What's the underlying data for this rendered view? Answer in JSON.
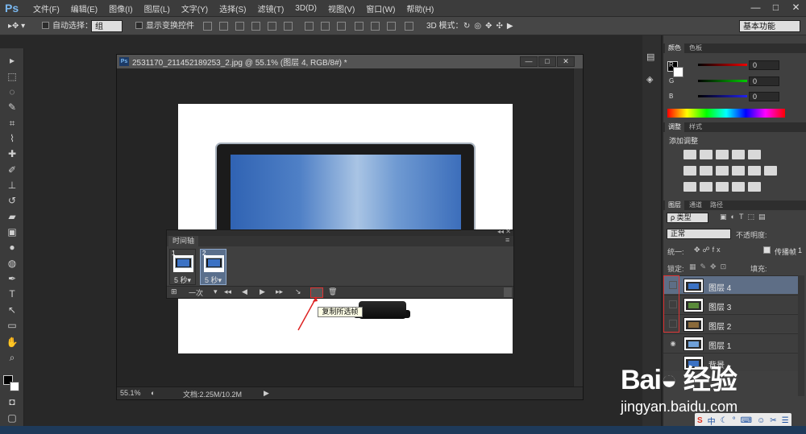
{
  "app": {
    "logo": "Ps"
  },
  "menubar": {
    "items": [
      "文件(F)",
      "编辑(E)",
      "图像(I)",
      "图层(L)",
      "文字(Y)",
      "选择(S)",
      "滤镜(T)",
      "3D(D)",
      "视图(V)",
      "窗口(W)",
      "帮助(H)"
    ],
    "min": "—",
    "max": "□",
    "close": "✕"
  },
  "options": {
    "auto_select": "自动选择：",
    "auto_select_value": "组",
    "show_transform": "显示变换控件",
    "mode3d": "3D 模式：",
    "workspace": "基本功能"
  },
  "document": {
    "title": "2531170_211452189253_2.jpg @ 55.1% (图层 4, RGB/8#) *",
    "zoom": "55.1%",
    "doc_info": "文档:2.25M/10.2M",
    "min": "—",
    "max": "□",
    "close": "✕"
  },
  "timeline": {
    "tab": "时间轴",
    "frames": [
      {
        "num": "1",
        "delay": "5 秒▾"
      },
      {
        "num": "2",
        "delay": "5 秒▾"
      }
    ],
    "loop": "一次",
    "tooltip": "复制所选帧"
  },
  "color_panel": {
    "tabs": [
      "颜色",
      "色板"
    ],
    "r_label": "R",
    "g_label": "G",
    "b_label": "B",
    "r": "0",
    "g": "0",
    "b": "0"
  },
  "adjust_panel": {
    "tabs": [
      "调整",
      "样式"
    ],
    "title": "添加调整"
  },
  "layers_panel": {
    "tabs": [
      "图层",
      "通道",
      "路径"
    ],
    "kind": "ρ 类型",
    "blend": "正常",
    "opacity_label": "不透明度:",
    "unify": "统一:",
    "propagate": "传播帧",
    "propagate_num": "1",
    "lock": "锁定:",
    "fill_label": "填充:",
    "layers": [
      {
        "name": "图层 4",
        "active": true,
        "vis": ""
      },
      {
        "name": "图层 3",
        "active": false,
        "vis": ""
      },
      {
        "name": "图层 2",
        "active": false,
        "vis": ""
      },
      {
        "name": "图层 1",
        "active": false,
        "vis": "◉"
      },
      {
        "name": "背景",
        "active": false,
        "vis": ""
      }
    ]
  },
  "watermark": {
    "brand": "Bai◒ 经验",
    "url": "jingyan.baidu.com"
  },
  "ime": {
    "items": [
      "S",
      "中",
      "☾",
      "°",
      "⌨",
      "☺",
      "✂",
      "☰"
    ]
  }
}
